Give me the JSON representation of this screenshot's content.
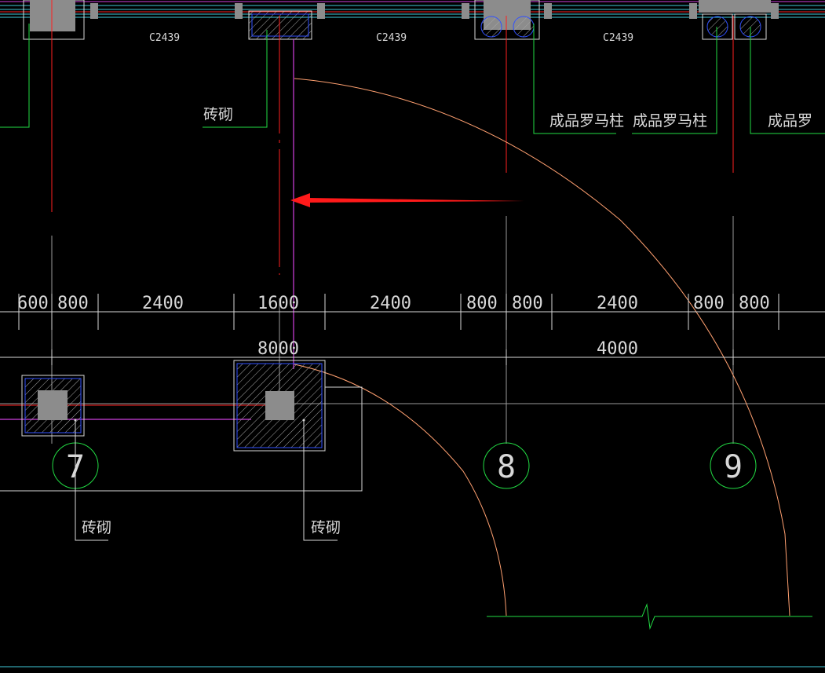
{
  "colors": {
    "background": "#000000",
    "axis_red": "#ff2020",
    "leader_green": "#22dd44",
    "dim_white": "#d8d8d8",
    "wall_cyan": "#40c8d8",
    "purple": "#d040e0",
    "arc_orange": "#ffa070",
    "hatch_blue": "#3050ff",
    "gray_fill": "#8c8c8c",
    "arrow_red": "#ff1a1a"
  },
  "window_labels": [
    "C2439",
    "C2439",
    "C2439"
  ],
  "top_notes": {
    "brick_top": "砖砌",
    "roman_col_1": "成品罗马柱",
    "roman_col_2": "成品罗马柱",
    "roman_col_3": "成品罗"
  },
  "dimensions": {
    "row1": [
      "600",
      "800",
      "2400",
      "1600",
      "2400",
      "800",
      "800",
      "2400",
      "800",
      "800"
    ],
    "row2": [
      "8000",
      "4000"
    ]
  },
  "axes": {
    "a7": "7",
    "a8": "8",
    "a9": "9"
  },
  "bottom_notes": {
    "brick_left": "砖砌",
    "brick_right": "砖砌"
  }
}
